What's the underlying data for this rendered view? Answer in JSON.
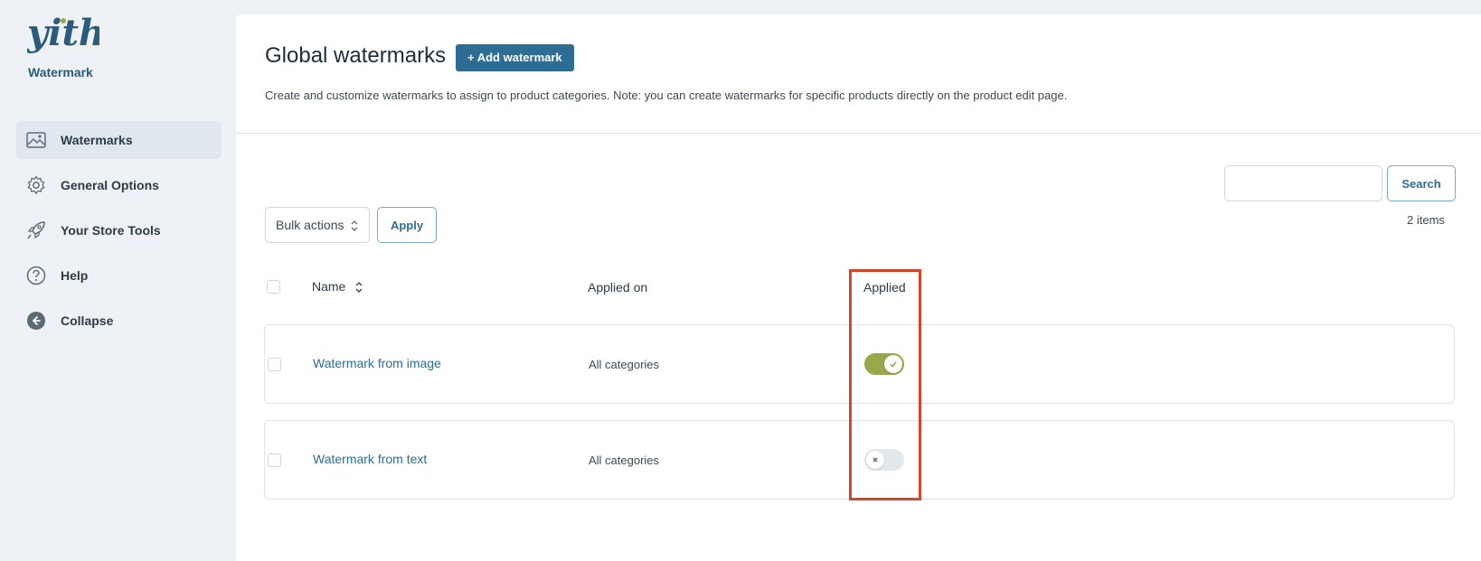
{
  "sidebar": {
    "plugin_name": "Watermark",
    "items": [
      {
        "label": "Watermarks",
        "icon": "image-icon",
        "active": true
      },
      {
        "label": "General Options",
        "icon": "gear-icon",
        "active": false
      },
      {
        "label": "Your Store Tools",
        "icon": "rocket-icon",
        "active": false
      },
      {
        "label": "Help",
        "icon": "help-circle-icon",
        "active": false
      },
      {
        "label": "Collapse",
        "icon": "collapse-arrow-icon",
        "active": false
      }
    ]
  },
  "header": {
    "title": "Global watermarks",
    "add_button": "+ Add watermark",
    "description": "Create and customize watermarks to assign to product categories. Note: you can create watermarks for specific products directly on the product edit page."
  },
  "toolbar": {
    "search_placeholder": "",
    "search_button": "Search",
    "item_count": "2 items",
    "bulk_actions": "Bulk actions",
    "apply_button": "Apply"
  },
  "table": {
    "columns": [
      "Name",
      "Applied on",
      "Applied"
    ],
    "rows": [
      {
        "name": "Watermark from image",
        "applied_on": "All categories",
        "applied": true
      },
      {
        "name": "Watermark from text",
        "applied_on": "All categories",
        "applied": false
      }
    ]
  },
  "colors": {
    "accent": "#2d6d93",
    "toggle_on": "#9aa74a",
    "highlight": "#d4462b"
  }
}
